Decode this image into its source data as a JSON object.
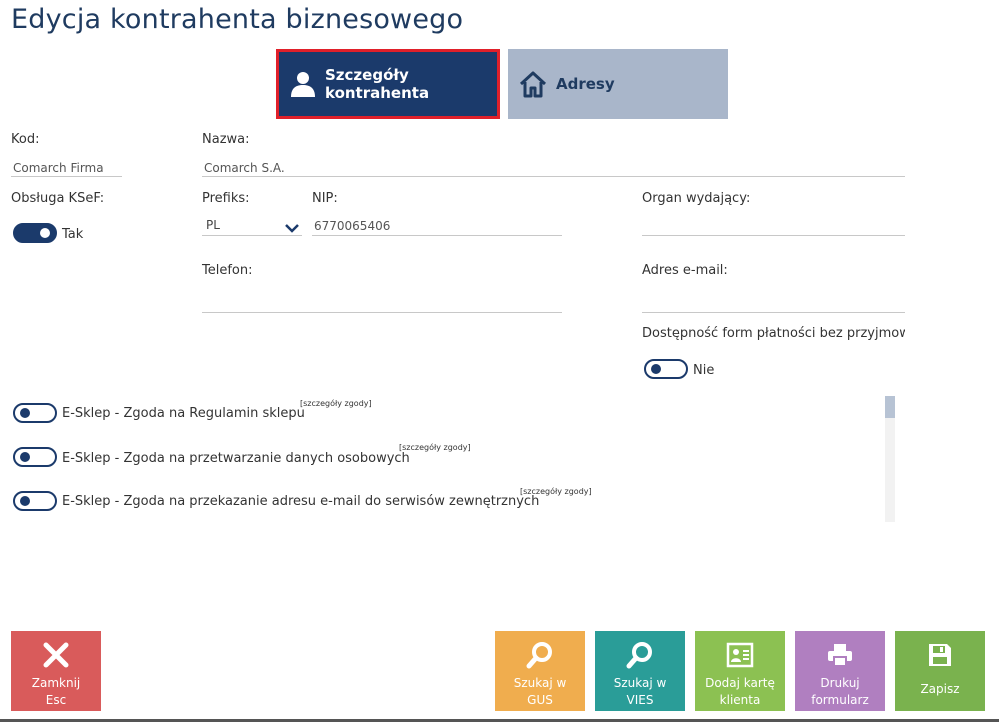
{
  "page": {
    "title": "Edycja kontrahenta biznesowego"
  },
  "tabs": {
    "details": {
      "label": "Szczegóły kontrahenta",
      "icon": "user-icon"
    },
    "addresses": {
      "label": "Adresy",
      "icon": "home-icon"
    }
  },
  "form": {
    "kod": {
      "label": "Kod:",
      "value": "Comarch Firma"
    },
    "nazwa": {
      "label": "Nazwa:",
      "value": "Comarch S.A."
    },
    "ksef": {
      "label": "Obsługa KSeF:",
      "state": "Tak",
      "on": true
    },
    "prefiks": {
      "label": "Prefiks:",
      "value": "PL"
    },
    "nip": {
      "label": "NIP:",
      "value": "6770065406"
    },
    "organ": {
      "label": "Organ wydający:",
      "value": ""
    },
    "telefon": {
      "label": "Telefon:",
      "value": ""
    },
    "email": {
      "label": "Adres e-mail:",
      "value": ""
    },
    "platnosci": {
      "label": "Dostępność form płatności bez przyjmowa",
      "state": "Nie",
      "on": false
    }
  },
  "consents": [
    {
      "text": "E-Sklep - Zgoda na Regulamin sklepu",
      "details": "[szczegóły zgody]"
    },
    {
      "text": "E-Sklep - Zgoda na przetwarzanie danych osobowych",
      "details": "[szczegóły zgody]"
    },
    {
      "text": "E-Sklep - Zgoda na przekazanie adresu e-mail do serwisów zewnętrznych",
      "details": "[szczegóły zgody]"
    }
  ],
  "buttons": {
    "close": {
      "line1": "Zamknij",
      "line2": "Esc",
      "color": "#d95b5b"
    },
    "gus": {
      "line1": "Szukaj w",
      "line2": "GUS",
      "color": "#f0ad4e"
    },
    "vies": {
      "line1": "Szukaj w",
      "line2": "VIES",
      "color": "#2a9d98"
    },
    "card": {
      "line1": "Dodaj kartę",
      "line2": "klienta",
      "color": "#8cc152"
    },
    "print": {
      "line1": "Drukuj",
      "line2": "formularz",
      "color": "#b07fc0"
    },
    "save": {
      "line1": "Zapisz",
      "color": "#7ab24e"
    }
  }
}
